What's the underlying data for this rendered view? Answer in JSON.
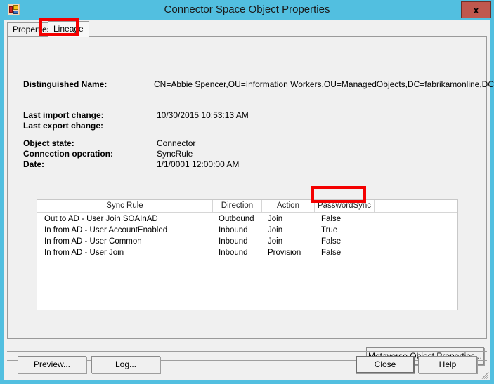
{
  "window": {
    "title": "Connector Space Object Properties",
    "icon": "properties-window-icon",
    "close_label": "x",
    "titlebar_color": "#52bfe0",
    "close_button_color": "#c0584e"
  },
  "tabs": [
    {
      "label": "Properties",
      "selected": false
    },
    {
      "label": "Lineage",
      "selected": true
    }
  ],
  "annotations": {
    "color": "#f40000",
    "targets": [
      "lineage-tab",
      "passwordsync-true-cell"
    ]
  },
  "details": {
    "distinguished_name_label": "Distinguished Name:",
    "distinguished_name_value": "CN=Abbie Spencer,OU=Information Workers,OU=ManagedObjects,DC=fabrikamonline,DC=com",
    "last_import_change_label": "Last import change:",
    "last_import_change_value": "10/30/2015 10:53:13 AM",
    "last_export_change_label": "Last export change:",
    "last_export_change_value": "",
    "object_state_label": "Object state:",
    "object_state_value": "Connector",
    "connection_operation_label": "Connection operation:",
    "connection_operation_value": "SyncRule",
    "date_label": "Date:",
    "date_value": "1/1/0001 12:00:00 AM"
  },
  "lineage_table": {
    "columns": [
      "Sync Rule",
      "Direction",
      "Action",
      "PasswordSync",
      ""
    ],
    "rows": [
      {
        "sync_rule": "Out to AD - User Join SOAInAD",
        "direction": "Outbound",
        "action": "Join",
        "password_sync": "False"
      },
      {
        "sync_rule": "In from AD - User AccountEnabled",
        "direction": "Inbound",
        "action": "Join",
        "password_sync": "True"
      },
      {
        "sync_rule": "In from AD - User Common",
        "direction": "Inbound",
        "action": "Join",
        "password_sync": "False"
      },
      {
        "sync_rule": "In from AD - User Join",
        "direction": "Inbound",
        "action": "Provision",
        "password_sync": "False"
      }
    ]
  },
  "buttons": {
    "metaverse": "Metaverse Object Properties...",
    "preview": "Preview...",
    "log": "Log...",
    "close": "Close",
    "help": "Help"
  }
}
